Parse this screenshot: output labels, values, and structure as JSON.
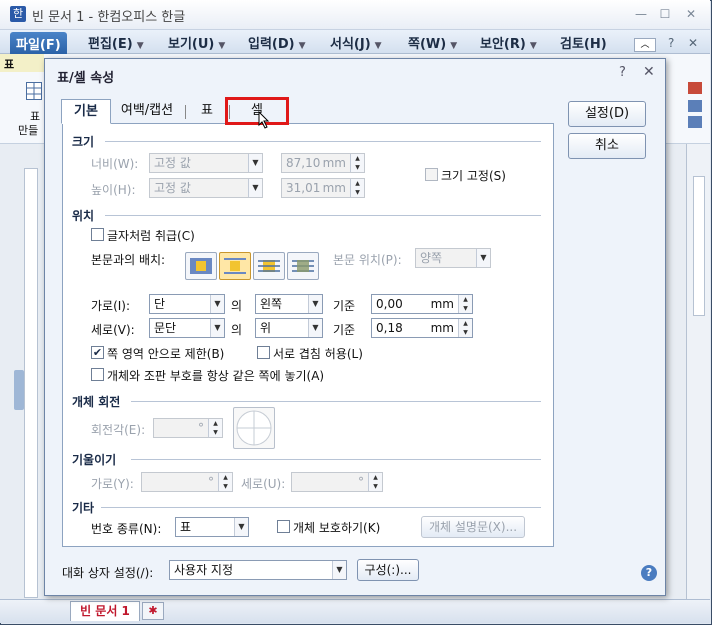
{
  "app": {
    "title": "빈 문서 1 - 한컴오피스 한글",
    "icon_glyph": "한"
  },
  "window_buttons": {
    "minimize": "—",
    "maximize": "☐",
    "close": "✕"
  },
  "ribbon_controls": {
    "help": "?",
    "restore": "✕"
  },
  "menubar": {
    "file": "파일(F)",
    "items": [
      {
        "label": "편집(E)"
      },
      {
        "label": "보기(U)"
      },
      {
        "label": "입력(D)"
      },
      {
        "label": "서식(J)"
      },
      {
        "label": "쪽(W)"
      },
      {
        "label": "보안(R)"
      },
      {
        "label": "검토(H)"
      }
    ],
    "more": "▸▸"
  },
  "ribbon": {
    "context_tab": "표",
    "left_labels": [
      "표",
      "만들"
    ]
  },
  "dialog": {
    "title": "표/셀 속성",
    "help": "?",
    "close": "✕",
    "tabs": [
      "기본",
      "여백/캡션",
      "표",
      "셀"
    ],
    "buttons": {
      "ok": "설정(D)",
      "cancel": "취소"
    },
    "size": {
      "section": "크기",
      "width_label": "너비(W):",
      "width_mode": "고정 값",
      "width_value": "87,10",
      "height_label": "높이(H):",
      "height_mode": "고정 값",
      "height_value": "31,01",
      "unit": "mm",
      "lock_label": "크기 고정(S)"
    },
    "position": {
      "section": "위치",
      "as_char_label": "글자처럼 취급(C)",
      "wrap_label": "본문과의 배치:",
      "body_pos_label": "본문 위치(P):",
      "body_pos_value": "양쪽",
      "horiz_label": "가로(I):",
      "horiz_ref": "단",
      "horiz_of": "의",
      "horiz_align": "왼쪽",
      "horiz_basis": "기준",
      "horiz_value": "0,00",
      "vert_label": "세로(V):",
      "vert_ref": "문단",
      "vert_of": "의",
      "vert_align": "위",
      "vert_basis": "기준",
      "vert_value": "0,18",
      "unit": "mm",
      "limit_label": "쪽 영역 안으로 제한(B)",
      "overlap_label": "서로 겹침 허용(L)",
      "same_page_label": "개체와 조판 부호를 항상 같은 쪽에 놓기(A)"
    },
    "rotation": {
      "section": "개체 회전",
      "angle_label": "회전각(E):",
      "angle_unit": "°"
    },
    "skew": {
      "section": "기울이기",
      "h_label": "가로(Y):",
      "v_label": "세로(U):",
      "unit": "°"
    },
    "etc": {
      "section": "기타",
      "numbering_label": "번호 종류(N):",
      "numbering_value": "표",
      "protect_label": "개체 보호하기(K)",
      "desc_button": "개체 설명문(X)..."
    },
    "footer": {
      "dialog_set_label": "대화 상자 설정(/):",
      "dialog_set_value": "사용자 지정",
      "config_button": "구성(:)...",
      "help_icon": "?"
    }
  },
  "statusbar": {
    "doc_tab": "빈 문서 1"
  },
  "colors": {
    "highlight": "#e01818",
    "accent": "#2b62a8"
  }
}
